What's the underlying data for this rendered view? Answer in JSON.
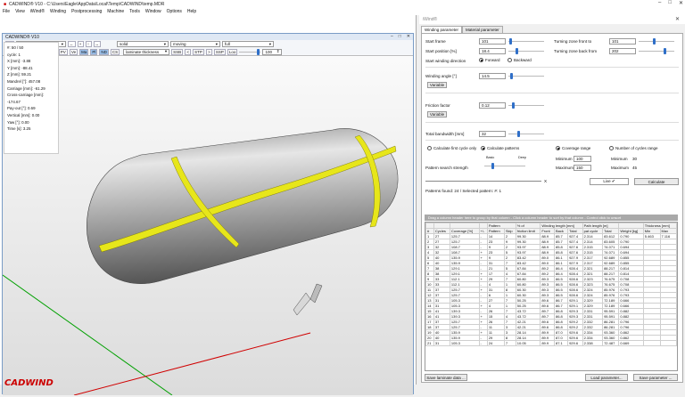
{
  "app": {
    "title": "CADWIND® V10  -  C:\\Users\\Eagle\\AppData\\Local\\Temp\\CADWIND\\temp.MDR",
    "logo": "CADWIND"
  },
  "menu": [
    "File",
    "View",
    "iWind®",
    "Winding",
    "Postprocessing",
    "Machine",
    "Tools",
    "Window",
    "Options",
    "Help"
  ],
  "doc": {
    "title": "CADWIND® V10"
  },
  "toolbar1": {
    "prefix": "1st",
    "view": "perspective",
    "nav": [
      "←",
      "+",
      "↑",
      "↔"
    ],
    "render": "solid",
    "motion": "moving",
    "extent": "full"
  },
  "toolbar2": {
    "buttons": [
      "Co",
      "Di",
      "MM",
      "PH",
      "PP",
      "PV",
      "Ve",
      "Ma",
      "Pl",
      "ND",
      "CS"
    ],
    "layer_select": "laminate thickness",
    "step_buttons": [
      "SSB",
      "<",
      "STP",
      ">",
      "SSP",
      "Loo"
    ],
    "counter": "100"
  },
  "info": [
    "#: 50 / 50",
    "cycle: 1",
    "X [mm]: -3.88",
    "Y [mm]: -88.41",
    "Z [mm]: 59.21",
    "Mandrel [°]: 457.08",
    "Carriage [mm]: -61.29",
    "Cross-carriage [mm]: -174.67",
    "Pay-out [°]: 0.69",
    "Vertical [mm]: 0.00",
    "Yaw [°]: 0.00",
    "Time [s]: 3.25"
  ],
  "panel": {
    "title": "iWind®",
    "tabs": [
      "Winding parameter",
      "Material parameter"
    ],
    "start_frame_label": "Start frame",
    "start_frame": "101",
    "start_position_label": "Start position [%]",
    "start_position": "18.4",
    "direction_label": "Start winding direction",
    "forward": "Forward",
    "backward": "Backward",
    "turn_front_label": "Turning zone front to",
    "turn_front": "101",
    "turn_back_label": "Turning zone back from",
    "turn_back": "202",
    "angle_label": "Winding angle [°]",
    "angle": "14.5",
    "variable": "Variable",
    "friction_label": "Friction factor",
    "friction": "0.12",
    "bandwidth_label": "Total bandwidth [mm]",
    "bandwidth": "32",
    "calc_first": "Calculate first cycle only",
    "calc_patterns": "Calculate patterns",
    "coverage_range": "Coverage range",
    "num_cycles": "Number of cycles range",
    "min_label": "Minimum",
    "min_cov": "100",
    "max_label": "Maximum",
    "max_cov": "150",
    "min_cycles_label": "Minimum",
    "min_cycles": "30",
    "max_cycles_label": "Maximum",
    "max_cycles": "45",
    "search_label": "Pattern search strength",
    "basic": "Basic",
    "deep": "Deep",
    "x": "X",
    "live_btn": "Live ✔",
    "calc_btn": "Calculate",
    "found": "Patterns found: 24 / Selected pattern: #: 1",
    "grid_hint": "Drag a column header here to group by that column - Click a column header to sort by that column - Control click to unsort",
    "save_btn": "Save laminate data ...",
    "load_btn": "Load parameter...",
    "savep_btn": "Save parameter ..."
  },
  "grid": {
    "group_headers": [
      "",
      "",
      "",
      "",
      "Pattern",
      "",
      "% of",
      "",
      "Winding length [mm]",
      "",
      "",
      "Path length [m]",
      "",
      "",
      "",
      "Thickness [mm]",
      ""
    ],
    "headers": [
      "#",
      "Cycles",
      "Coverage [%]",
      "+/-",
      "Pattern",
      "Skip",
      "friction limit",
      "Front",
      "Back",
      "Total",
      "pat cycle",
      "Total",
      "Weight [kg]",
      "Min",
      "Max"
    ],
    "rows": [
      [
        "1",
        "27",
        "125.7",
        "-",
        "14",
        "2",
        "99.30",
        "88.9",
        "85.7",
        "927.4",
        "2.314",
        "83.612",
        "0.790",
        "5.463",
        "7.116"
      ],
      [
        "2",
        "27",
        "125.7",
        "-",
        "23",
        "9",
        "99.30",
        "88.9",
        "85.7",
        "927.4",
        "2.314",
        "83.605",
        "0.790",
        "",
        ""
      ],
      [
        "3",
        "32",
        "108.7",
        "-",
        "9",
        "2",
        "93.97",
        "88.9",
        "85.8",
        "927.6",
        "2.315",
        "74.071",
        "0.694",
        "",
        ""
      ],
      [
        "4",
        "32",
        "108.7",
        "+",
        "23",
        "5",
        "93.97",
        "88.9",
        "85.8",
        "927.6",
        "2.315",
        "74.071",
        "0.694",
        "",
        ""
      ],
      [
        "5",
        "40",
        "135.9",
        "+",
        "9",
        "2",
        "83.42",
        "89.0",
        "86.1",
        "927.9",
        "2.317",
        "92.689",
        "0.855",
        "",
        ""
      ],
      [
        "6",
        "40",
        "135.9",
        "-",
        "31",
        "7",
        "83.42",
        "89.0",
        "86.1",
        "927.9",
        "2.317",
        "92.689",
        "0.855",
        "",
        ""
      ],
      [
        "7",
        "38",
        "129.1",
        "-",
        "21",
        "5",
        "67.84",
        "89.2",
        "86.4",
        "928.4",
        "2.321",
        "88.217",
        "0.814",
        "",
        ""
      ],
      [
        "8",
        "38",
        "129.1",
        "+",
        "17",
        "4",
        "67.84",
        "89.2",
        "86.4",
        "928.4",
        "2.321",
        "88.217",
        "0.814",
        "",
        ""
      ],
      [
        "9",
        "33",
        "112.1",
        "+",
        "29",
        "7",
        "60.80",
        "89.3",
        "86.5",
        "928.6",
        "2.323",
        "76.675",
        "0.708",
        "",
        ""
      ],
      [
        "10",
        "33",
        "112.1",
        "-",
        "4",
        "1",
        "60.80",
        "89.3",
        "86.5",
        "928.6",
        "2.323",
        "76.675",
        "0.708",
        "",
        ""
      ],
      [
        "11",
        "37",
        "125.7",
        "+",
        "31",
        "8",
        "60.30",
        "89.3",
        "86.5",
        "928.6",
        "2.324",
        "85.976",
        "0.793",
        "",
        ""
      ],
      [
        "12",
        "37",
        "125.7",
        "-",
        "6",
        "1",
        "60.30",
        "89.3",
        "86.5",
        "928.6",
        "2.324",
        "85.976",
        "0.793",
        "",
        ""
      ],
      [
        "13",
        "31",
        "105.3",
        "-",
        "27",
        "7",
        "50.25",
        "89.6",
        "86.7",
        "929.1",
        "2.329",
        "72.189",
        "0.666",
        "",
        ""
      ],
      [
        "14",
        "31",
        "105.3",
        "+",
        "4",
        "1",
        "50.25",
        "89.6",
        "86.7",
        "929.1",
        "2.329",
        "72.189",
        "0.666",
        "",
        ""
      ],
      [
        "15",
        "41",
        "139.3",
        "-",
        "26",
        "7",
        "43.72",
        "89.7",
        "86.8",
        "929.3",
        "2.331",
        "95.591",
        "0.882",
        "",
        ""
      ],
      [
        "16",
        "41",
        "139.3",
        "+",
        "15",
        "4",
        "43.72",
        "89.7",
        "86.8",
        "929.3",
        "2.331",
        "95.591",
        "0.882",
        "",
        ""
      ],
      [
        "17",
        "37",
        "125.7",
        "+",
        "26",
        "7",
        "42.21",
        "89.6",
        "86.8",
        "929.2",
        "2.332",
        "86.281",
        "0.796",
        "",
        ""
      ],
      [
        "18",
        "37",
        "125.7",
        "-",
        "11",
        "3",
        "42.21",
        "89.6",
        "86.8",
        "929.2",
        "2.332",
        "86.281",
        "0.796",
        "",
        ""
      ],
      [
        "19",
        "40",
        "135.9",
        "+",
        "11",
        "3",
        "28.14",
        "89.9",
        "87.0",
        "929.6",
        "2.334",
        "93.360",
        "0.862",
        "",
        ""
      ],
      [
        "20",
        "40",
        "135.9",
        "-",
        "29",
        "8",
        "28.14",
        "89.9",
        "87.0",
        "929.6",
        "2.334",
        "93.360",
        "0.862",
        "",
        ""
      ],
      [
        "21",
        "31",
        "105.3",
        "-",
        "24",
        "7",
        "10.05",
        "89.9",
        "87.1",
        "929.6",
        "2.338",
        "72.487",
        "0.669",
        "",
        ""
      ]
    ]
  },
  "colors": {
    "accent": "#2f6fc8",
    "laminate_yellow": "#e7e61a",
    "logo_red": "#cc0000",
    "axis_green": "#00a000",
    "axis_red": "#d00000"
  }
}
